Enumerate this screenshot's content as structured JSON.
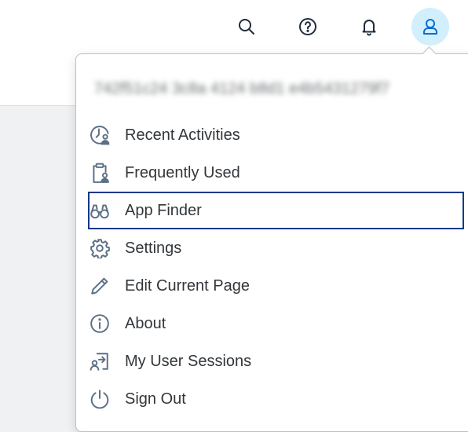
{
  "header": {
    "actions": [
      {
        "name": "search-icon"
      },
      {
        "name": "help-icon"
      },
      {
        "name": "notifications-bell-icon"
      },
      {
        "name": "user-avatar-icon"
      }
    ]
  },
  "user_menu": {
    "user_name": "742f51c24 3c8a 4124 b8d1 e4b5431279f7",
    "items": [
      {
        "label": "Recent Activities",
        "icon": "recent-activities-icon"
      },
      {
        "label": "Frequently Used",
        "icon": "frequently-used-icon"
      },
      {
        "label": "App Finder",
        "icon": "app-finder-binoculars-icon",
        "focused": true
      },
      {
        "label": "Settings",
        "icon": "settings-gear-icon"
      },
      {
        "label": "Edit Current Page",
        "icon": "edit-pencil-icon"
      },
      {
        "label": "About",
        "icon": "about-info-icon"
      },
      {
        "label": "My User Sessions",
        "icon": "user-sessions-icon"
      },
      {
        "label": "Sign Out",
        "icon": "sign-out-power-icon"
      }
    ]
  },
  "colors": {
    "accent": "#0a3a8a",
    "icon": "#5b6f86",
    "avatar_bg": "#d1effc",
    "avatar_icon": "#0a6ed1"
  }
}
